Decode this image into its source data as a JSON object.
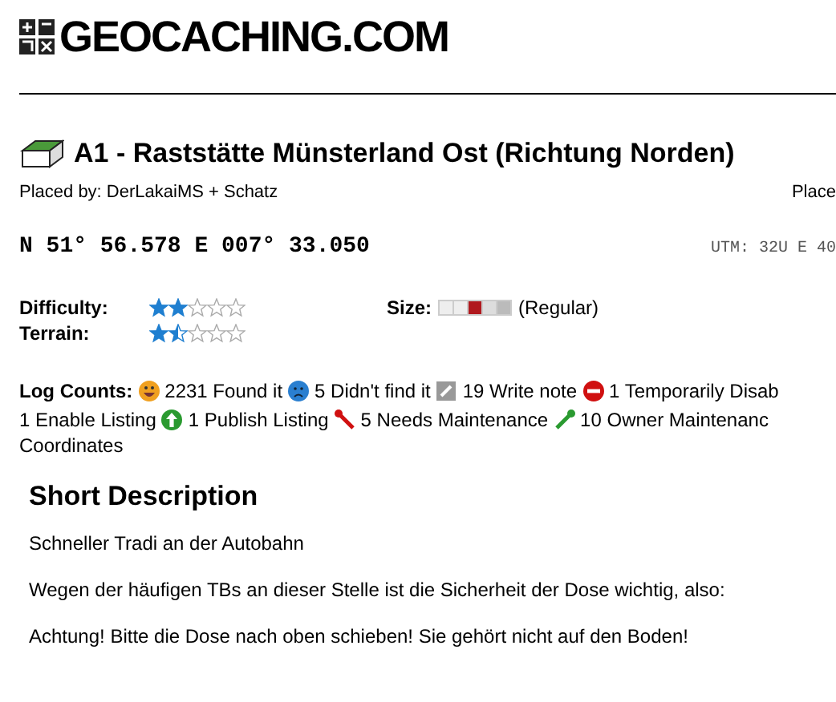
{
  "logo": {
    "text": "GEOCACHING.COM"
  },
  "cache": {
    "title": "A1 - Raststätte Münsterland Ost (Richtung Norden)",
    "placed_by": "Placed by: DerLakaiMS + Schatz",
    "placed_right": "Place"
  },
  "coordinates": {
    "text": "N 51° 56.578 E 007° 33.050",
    "utm": "UTM: 32U E 40"
  },
  "ratings": [
    {
      "label": "Difficulty:",
      "stars": 2
    },
    {
      "label": "Terrain:",
      "stars": 1.5
    }
  ],
  "size": {
    "label": "Size:",
    "value": "(Regular)"
  },
  "log_counts": {
    "label": "Log Counts:",
    "lines": [
      [
        {
          "kind": "found",
          "text": "2231 Found it"
        },
        {
          "kind": "dnf",
          "text": "5 Didn't find it"
        },
        {
          "kind": "note",
          "text": "19 Write note"
        },
        {
          "kind": "disable",
          "text": "1 Temporarily Disab"
        }
      ],
      [
        {
          "kind": "plain",
          "text": "1 Enable Listing"
        },
        {
          "kind": "publish",
          "text": "1 Publish Listing"
        },
        {
          "kind": "needs",
          "text": "5 Needs Maintenance"
        },
        {
          "kind": "owner",
          "text": "10 Owner Maintenanc"
        }
      ],
      [
        {
          "kind": "plain",
          "text": "Coordinates"
        }
      ]
    ]
  },
  "short_description": {
    "heading": "Short Description",
    "paragraphs": [
      "Schneller Tradi an der Autobahn",
      "Wegen der häufigen TBs an dieser Stelle ist die Sicherheit der Dose wichtig, also:",
      "Achtung! Bitte die Dose nach oben schieben! Sie gehört nicht auf den Boden!"
    ]
  }
}
